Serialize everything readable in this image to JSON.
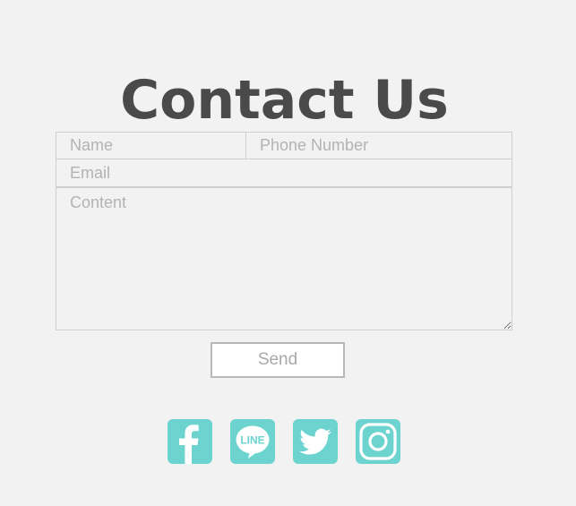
{
  "page": {
    "title": "Contact Us"
  },
  "form": {
    "name_placeholder": "Name",
    "phone_placeholder": "Phone Number",
    "email_placeholder": "Email",
    "content_placeholder": "Content",
    "send_label": "Send"
  },
  "social": {
    "accent_color": "#6dd3cf",
    "items": [
      {
        "icon": "facebook-icon"
      },
      {
        "icon": "line-icon",
        "label": "LINE"
      },
      {
        "icon": "twitter-icon"
      },
      {
        "icon": "instagram-icon"
      }
    ]
  },
  "colors": {
    "background": "#f2f2f2",
    "title": "#4a4a4a",
    "border": "#cfcfcf",
    "placeholder": "#b3b3b3"
  }
}
